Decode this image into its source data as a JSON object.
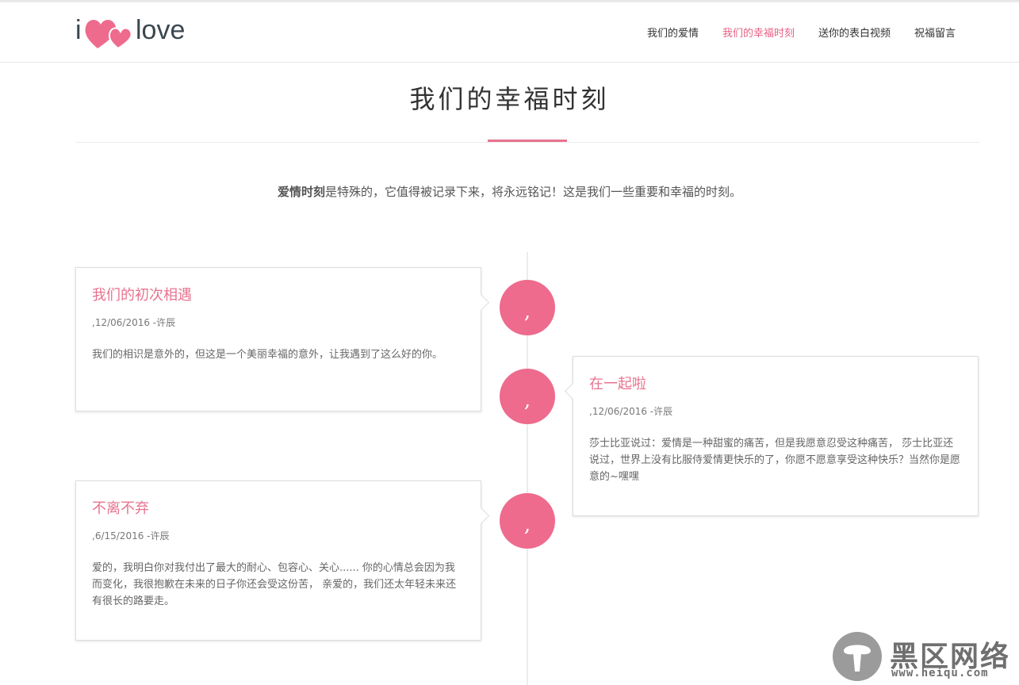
{
  "header": {
    "logo_i": "i",
    "logo_love": "love",
    "nav": [
      {
        "label": "我们的爱情",
        "active": false
      },
      {
        "label": "我们的幸福时刻",
        "active": true
      },
      {
        "label": "送你的表白视频",
        "active": false
      },
      {
        "label": "祝福留言",
        "active": false
      }
    ]
  },
  "page": {
    "title": "我们的幸福时刻",
    "intro_bold": "爱情时刻",
    "intro_rest": "是特殊的，它值得被记录下来，将永远铭记！这是我们一些重要和幸福的时刻。"
  },
  "timeline": [
    {
      "title": "我们的初次相遇",
      "meta": ",12/06/2016 -许辰",
      "body": "我们的相识是意外的，但这是一个美丽幸福的意外，让我遇到了这么好的你。",
      "dot": ","
    },
    {
      "title": "在一起啦",
      "meta": ",12/06/2016 -许辰",
      "body": "莎士比亚说过：爱情是一种甜蜜的痛苦，但是我愿意忍受这种痛苦， 莎士比亚还说过，世界上没有比服侍爱情更快乐的了，你愿不愿意享受这种快乐？当然你是愿意的~嘿嘿",
      "dot": ","
    },
    {
      "title": "不离不弃",
      "meta": ",6/15/2016 -许辰",
      "body": "爱的，我明白你对我付出了最大的耐心、包容心、关心...... 你的心情总会因为我而变化，我很抱歉在未来的日子你还会受这份苦， 亲爱的，我们还太年轻未来还有很长的路要走。",
      "dot": ","
    }
  ],
  "watermark": {
    "text": "黑区网络",
    "url": "www.heiqu.com"
  },
  "colors": {
    "accent": "#e8738f",
    "dot": "#ee6b8d",
    "text": "#555555"
  }
}
